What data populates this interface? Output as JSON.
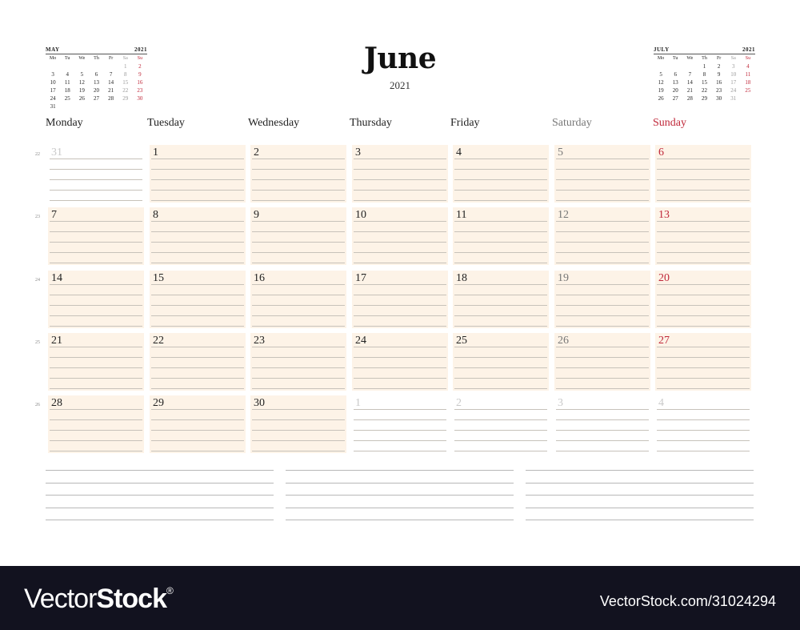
{
  "title": "June",
  "year": "2021",
  "weekdays": [
    {
      "label": "Monday",
      "kind": "wd"
    },
    {
      "label": "Tuesday",
      "kind": "wd"
    },
    {
      "label": "Wednesday",
      "kind": "wd"
    },
    {
      "label": "Thursday",
      "kind": "wd"
    },
    {
      "label": "Friday",
      "kind": "wd"
    },
    {
      "label": "Saturday",
      "kind": "sat"
    },
    {
      "label": "Sunday",
      "kind": "sun"
    }
  ],
  "mini_calendars": {
    "prev": {
      "month": "MAY",
      "year": "2021",
      "weekday_abbr": [
        "Mo",
        "Tu",
        "We",
        "Th",
        "Fr",
        "Sa",
        "Su"
      ],
      "weeks": [
        [
          "",
          "",
          "",
          "",
          "",
          "1",
          "2"
        ],
        [
          "3",
          "4",
          "5",
          "6",
          "7",
          "8",
          "9"
        ],
        [
          "10",
          "11",
          "12",
          "13",
          "14",
          "15",
          "16"
        ],
        [
          "17",
          "18",
          "19",
          "20",
          "21",
          "22",
          "23"
        ],
        [
          "24",
          "25",
          "26",
          "27",
          "28",
          "29",
          "30"
        ],
        [
          "31",
          "",
          "",
          "",
          "",
          "",
          ""
        ]
      ]
    },
    "next": {
      "month": "JULY",
      "year": "2021",
      "weekday_abbr": [
        "Mo",
        "Tu",
        "We",
        "Th",
        "Fr",
        "Sa",
        "Su"
      ],
      "weeks": [
        [
          "",
          "",
          "",
          "1",
          "2",
          "3",
          "4"
        ],
        [
          "5",
          "6",
          "7",
          "8",
          "9",
          "10",
          "11"
        ],
        [
          "12",
          "13",
          "14",
          "15",
          "16",
          "17",
          "18"
        ],
        [
          "19",
          "20",
          "21",
          "22",
          "23",
          "24",
          "25"
        ],
        [
          "26",
          "27",
          "28",
          "29",
          "30",
          "31",
          ""
        ]
      ]
    }
  },
  "weeks": [
    {
      "week_number": "22",
      "days": [
        {
          "d": "31",
          "in": false
        },
        {
          "d": "1",
          "in": true
        },
        {
          "d": "2",
          "in": true
        },
        {
          "d": "3",
          "in": true
        },
        {
          "d": "4",
          "in": true
        },
        {
          "d": "5",
          "in": true
        },
        {
          "d": "6",
          "in": true
        }
      ]
    },
    {
      "week_number": "23",
      "days": [
        {
          "d": "7",
          "in": true
        },
        {
          "d": "8",
          "in": true
        },
        {
          "d": "9",
          "in": true
        },
        {
          "d": "10",
          "in": true
        },
        {
          "d": "11",
          "in": true
        },
        {
          "d": "12",
          "in": true
        },
        {
          "d": "13",
          "in": true
        }
      ]
    },
    {
      "week_number": "24",
      "days": [
        {
          "d": "14",
          "in": true
        },
        {
          "d": "15",
          "in": true
        },
        {
          "d": "16",
          "in": true
        },
        {
          "d": "17",
          "in": true
        },
        {
          "d": "18",
          "in": true
        },
        {
          "d": "19",
          "in": true
        },
        {
          "d": "20",
          "in": true
        }
      ]
    },
    {
      "week_number": "25",
      "days": [
        {
          "d": "21",
          "in": true
        },
        {
          "d": "22",
          "in": true
        },
        {
          "d": "23",
          "in": true
        },
        {
          "d": "24",
          "in": true
        },
        {
          "d": "25",
          "in": true
        },
        {
          "d": "26",
          "in": true
        },
        {
          "d": "27",
          "in": true
        }
      ]
    },
    {
      "week_number": "26",
      "days": [
        {
          "d": "28",
          "in": true
        },
        {
          "d": "29",
          "in": true
        },
        {
          "d": "30",
          "in": true
        },
        {
          "d": "1",
          "in": false
        },
        {
          "d": "2",
          "in": false
        },
        {
          "d": "3",
          "in": false
        },
        {
          "d": "4",
          "in": false
        }
      ]
    }
  ],
  "notes": {
    "columns": 3,
    "lines_per_column": 5
  },
  "colors": {
    "cell_fill": "#fdf3e7",
    "sunday": "#c0283a",
    "saturday": "#777777",
    "footer_bg": "#12121f"
  },
  "footer": {
    "brand_light": "Vector",
    "brand_bold": "Stock",
    "brand_mark": "®",
    "url": "VectorStock.com/31024294"
  }
}
